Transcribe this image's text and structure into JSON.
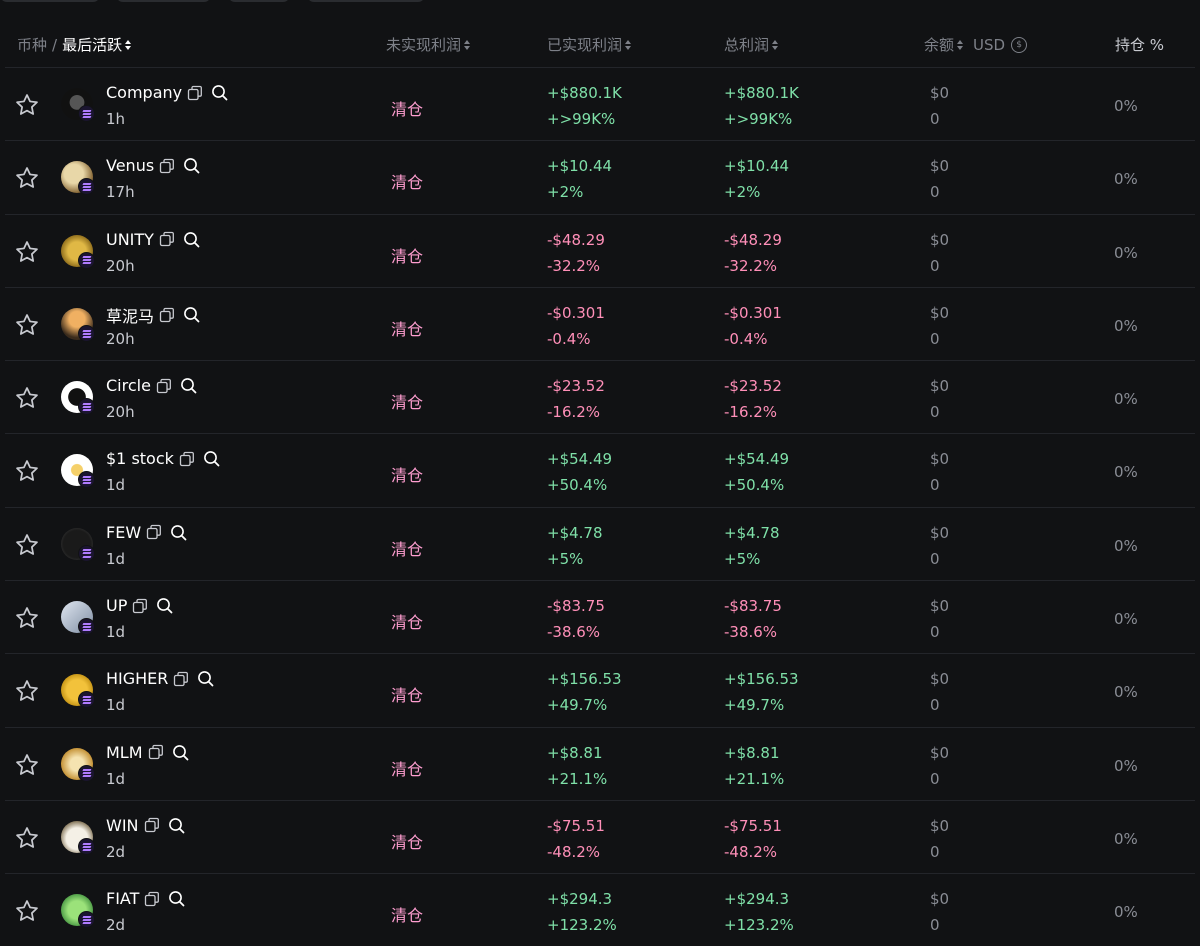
{
  "header": {
    "coin_label": "币种",
    "separator": "/",
    "last_active_label": "最后活跃",
    "unrealized_label": "未实现利润",
    "realized_label": "已实现利润",
    "total_label": "总利润",
    "balance_label": "余额",
    "currency_label": "USD",
    "holding_label": "持仓 %"
  },
  "colors": {
    "positive": "#7fe0a8",
    "negative": "#ff8fb8",
    "cleared": "#ff9ed0",
    "background": "#111214"
  },
  "rows": [
    {
      "name": "Company",
      "age": "1h",
      "status": "清仓",
      "realized": "+$880.1K",
      "realized_pct": "+>99K%",
      "total": "+$880.1K",
      "total_pct": "+>99K%",
      "balance": "$0",
      "balance_qty": "0",
      "holding": "0%",
      "sign": "pos"
    },
    {
      "name": "Venus",
      "age": "17h",
      "status": "清仓",
      "realized": "+$10.44",
      "realized_pct": "+2%",
      "total": "+$10.44",
      "total_pct": "+2%",
      "balance": "$0",
      "balance_qty": "0",
      "holding": "0%",
      "sign": "pos"
    },
    {
      "name": "UNITY",
      "age": "20h",
      "status": "清仓",
      "realized": "-$48.29",
      "realized_pct": "-32.2%",
      "total": "-$48.29",
      "total_pct": "-32.2%",
      "balance": "$0",
      "balance_qty": "0",
      "holding": "0%",
      "sign": "neg"
    },
    {
      "name": "草泥马",
      "age": "20h",
      "status": "清仓",
      "realized": "-$0.301",
      "realized_pct": "-0.4%",
      "total": "-$0.301",
      "total_pct": "-0.4%",
      "balance": "$0",
      "balance_qty": "0",
      "holding": "0%",
      "sign": "neg"
    },
    {
      "name": "Circle",
      "age": "20h",
      "status": "清仓",
      "realized": "-$23.52",
      "realized_pct": "-16.2%",
      "total": "-$23.52",
      "total_pct": "-16.2%",
      "balance": "$0",
      "balance_qty": "0",
      "holding": "0%",
      "sign": "neg"
    },
    {
      "name": "$1 stock",
      "age": "1d",
      "status": "清仓",
      "realized": "+$54.49",
      "realized_pct": "+50.4%",
      "total": "+$54.49",
      "total_pct": "+50.4%",
      "balance": "$0",
      "balance_qty": "0",
      "holding": "0%",
      "sign": "pos"
    },
    {
      "name": "FEW",
      "age": "1d",
      "status": "清仓",
      "realized": "+$4.78",
      "realized_pct": "+5%",
      "total": "+$4.78",
      "total_pct": "+5%",
      "balance": "$0",
      "balance_qty": "0",
      "holding": "0%",
      "sign": "pos"
    },
    {
      "name": "UP",
      "age": "1d",
      "status": "清仓",
      "realized": "-$83.75",
      "realized_pct": "-38.6%",
      "total": "-$83.75",
      "total_pct": "-38.6%",
      "balance": "$0",
      "balance_qty": "0",
      "holding": "0%",
      "sign": "neg"
    },
    {
      "name": "HIGHER",
      "age": "1d",
      "status": "清仓",
      "realized": "+$156.53",
      "realized_pct": "+49.7%",
      "total": "+$156.53",
      "total_pct": "+49.7%",
      "balance": "$0",
      "balance_qty": "0",
      "holding": "0%",
      "sign": "pos"
    },
    {
      "name": "MLM",
      "age": "1d",
      "status": "清仓",
      "realized": "+$8.81",
      "realized_pct": "+21.1%",
      "total": "+$8.81",
      "total_pct": "+21.1%",
      "balance": "$0",
      "balance_qty": "0",
      "holding": "0%",
      "sign": "pos"
    },
    {
      "name": "WIN",
      "age": "2d",
      "status": "清仓",
      "realized": "-$75.51",
      "realized_pct": "-48.2%",
      "total": "-$75.51",
      "total_pct": "-48.2%",
      "balance": "$0",
      "balance_qty": "0",
      "holding": "0%",
      "sign": "neg"
    },
    {
      "name": "FIAT",
      "age": "2d",
      "status": "清仓",
      "realized": "+$294.3",
      "realized_pct": "+123.2%",
      "total": "+$294.3",
      "total_pct": "+123.2%",
      "balance": "$0",
      "balance_qty": "0",
      "holding": "0%",
      "sign": "pos"
    }
  ]
}
